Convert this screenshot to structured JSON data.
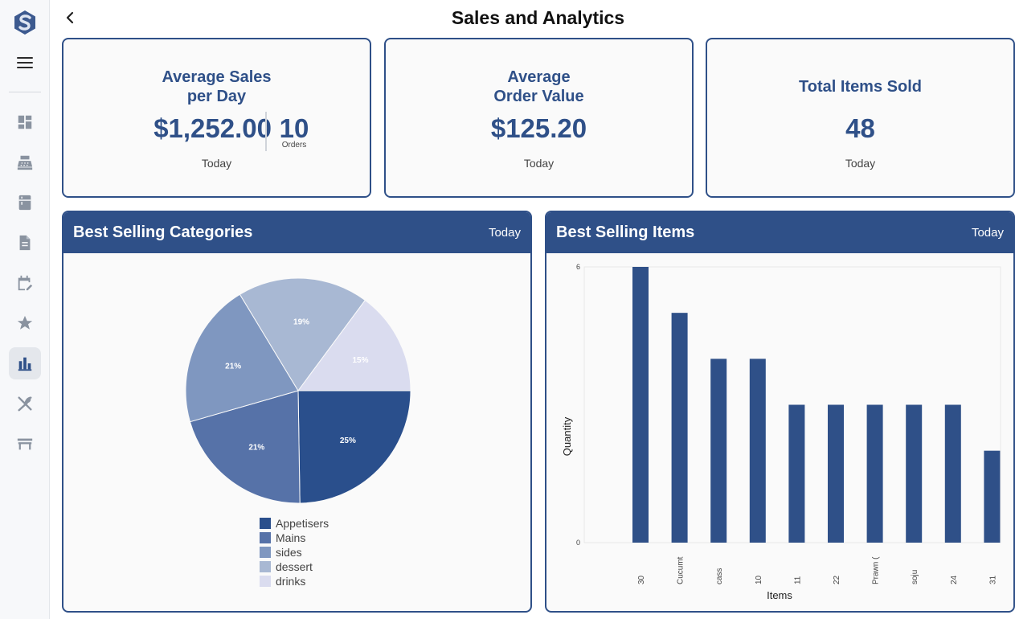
{
  "header": {
    "title": "Sales and Analytics"
  },
  "sidebar": {
    "items": [
      {
        "name": "dashboard-icon"
      },
      {
        "name": "cash-register-icon"
      },
      {
        "name": "kitchen-icon"
      },
      {
        "name": "document-icon"
      },
      {
        "name": "calendar-edit-icon"
      },
      {
        "name": "star-icon"
      },
      {
        "name": "bar-chart-icon",
        "active": true
      },
      {
        "name": "utensils-icon"
      },
      {
        "name": "table-icon"
      }
    ]
  },
  "stats": {
    "avg_sales": {
      "title_line1": "Average Sales",
      "title_line2": "per Day",
      "value": "$1,252.00",
      "orders_value": "10",
      "orders_label": "Orders",
      "period": "Today"
    },
    "avg_order": {
      "title_line1": "Average",
      "title_line2": "Order Value",
      "value": "$125.20",
      "period": "Today"
    },
    "total_items": {
      "title": "Total Items Sold",
      "value": "48",
      "period": "Today"
    }
  },
  "colors": {
    "primary": "#2f5088",
    "pie": [
      "#2a4f8c",
      "#5672a8",
      "#7f97c0",
      "#a8b8d3",
      "#dadcef"
    ]
  },
  "chart_data": [
    {
      "type": "pie",
      "title": "Best Selling Categories",
      "period": "Today",
      "categories": [
        "Appetisers",
        "Mains",
        "sides",
        "dessert",
        "drinks"
      ],
      "values": [
        25,
        21,
        21,
        19,
        15
      ],
      "labels": [
        "25%",
        "21%",
        "21%",
        "19%",
        "15%"
      ],
      "legend": "bottom"
    },
    {
      "type": "bar",
      "title": "Best Selling Items",
      "period": "Today",
      "categories": [
        "30",
        "Cucumt",
        "cass",
        "10",
        "11",
        "22",
        "Prawn (",
        "soju",
        "24",
        "31"
      ],
      "values": [
        6,
        5,
        4,
        4,
        3,
        3,
        3,
        3,
        3,
        2
      ],
      "xlabel": "Items",
      "ylabel": "Quantity",
      "ylim": [
        0,
        6
      ],
      "yticks": [
        "0",
        "6"
      ]
    }
  ]
}
